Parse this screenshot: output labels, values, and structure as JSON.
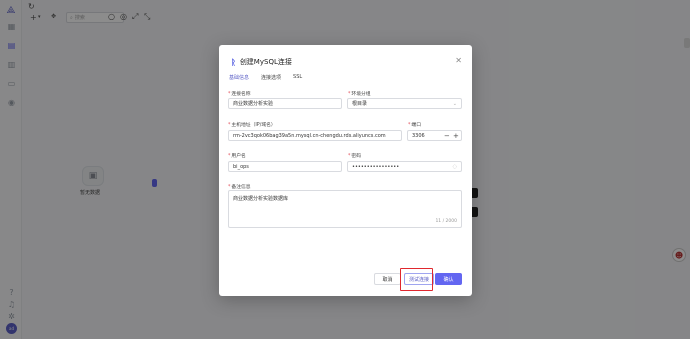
{
  "toolbar": {
    "search_placeholder": "搜索",
    "icons": [
      "refresh-icon",
      "add-icon",
      "circle-icon",
      "target-icon",
      "expand-icon",
      "collapse-icon"
    ]
  },
  "canvas": {
    "empty_label": "暂无数据"
  },
  "modal": {
    "title": "创建MySQL连接",
    "tabs": [
      "基础信息",
      "连接选项",
      "SSL"
    ],
    "active_tab": "基础信息",
    "fields": {
      "conn_name": {
        "label": "连接名称",
        "value": "商业数据分析实验"
      },
      "env_group": {
        "label": "环境分组",
        "value": "根目录"
      },
      "host": {
        "label": "主机地址（IP/域名）",
        "value": "rm-2vc3qok06bag39a5n.mysql.cn-chengdu.rds.aliyuncs.com"
      },
      "port": {
        "label": "端口",
        "value": "3306"
      },
      "username": {
        "label": "用户名",
        "value": "bi_ops"
      },
      "password": {
        "label": "密码",
        "value": "••••••••••••••••"
      },
      "remark": {
        "label": "备注信息",
        "value": "商业数据分析实验数据库",
        "counter": "11 / 2000"
      }
    },
    "buttons": {
      "cancel": "取消",
      "test": "测试连接",
      "ok": "确认"
    }
  },
  "colors": {
    "accent": "#6366f1",
    "highlight": "#e0282e"
  }
}
